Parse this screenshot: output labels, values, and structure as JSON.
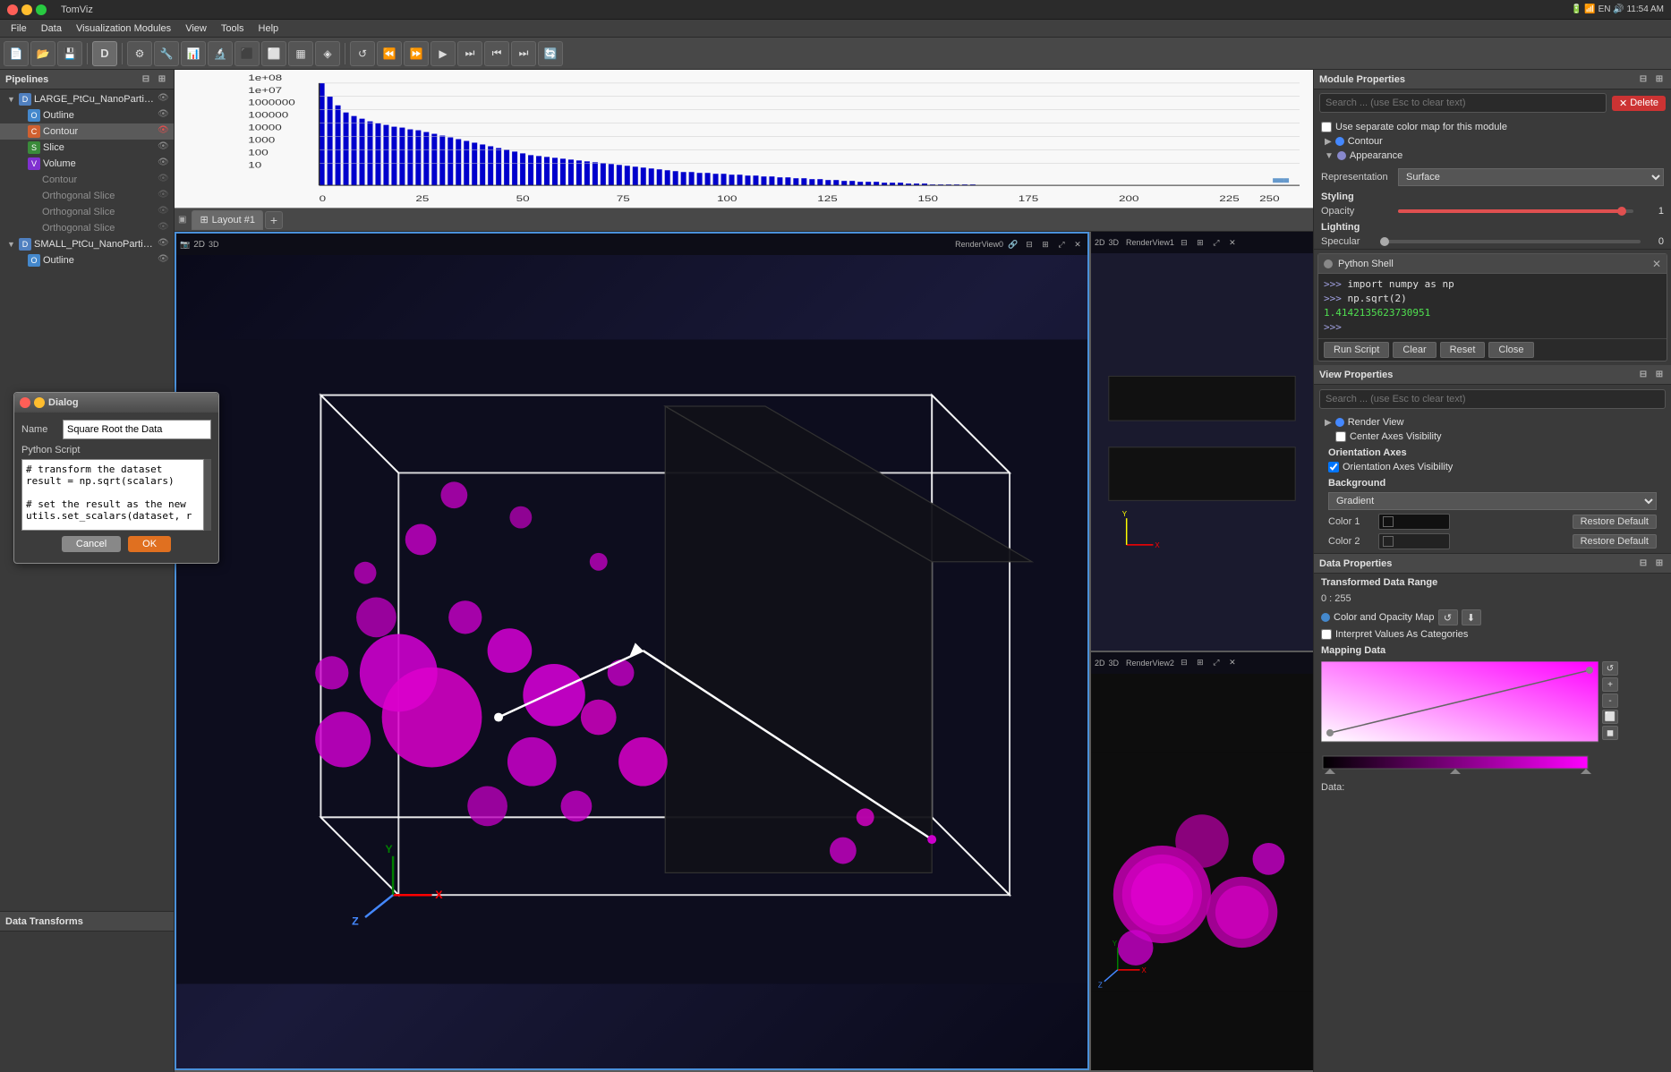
{
  "titlebar": {
    "title": "TomViz",
    "close_label": "×",
    "min_label": "−",
    "max_label": "□",
    "right_icons": "🔋 📶 EN 🔊 11:54 AM"
  },
  "menubar": {
    "items": [
      "File",
      "Data",
      "Visualization Modules",
      "View",
      "Tools",
      "Help"
    ]
  },
  "pipelines": {
    "header": "Pipelines",
    "items": [
      {
        "id": "large-dataset",
        "label": "LARGE_PtCu_NanoParticl...",
        "type": "dataset",
        "indent": 0,
        "expanded": true,
        "eye": true
      },
      {
        "id": "outline-1",
        "label": "Outline",
        "type": "outline",
        "indent": 1,
        "eye": true
      },
      {
        "id": "contour-1",
        "label": "Contour",
        "type": "contour",
        "indent": 1,
        "eye": true,
        "selected": true,
        "eye_red": true
      },
      {
        "id": "slice-1",
        "label": "Slice",
        "type": "slice",
        "indent": 1,
        "eye": true
      },
      {
        "id": "volume-1",
        "label": "Volume",
        "type": "volume",
        "indent": 1,
        "eye": true
      },
      {
        "id": "contour-2",
        "label": "Contour",
        "type": "contour",
        "indent": 2,
        "eye": false,
        "dimmed": true
      },
      {
        "id": "orthoslice-1",
        "label": "Orthogonal Slice",
        "type": "orthoslice",
        "indent": 2,
        "eye": false,
        "dimmed": true
      },
      {
        "id": "orthoslice-2",
        "label": "Orthogonal Slice",
        "type": "orthoslice",
        "indent": 2,
        "eye": false,
        "dimmed": true
      },
      {
        "id": "orthoslice-3",
        "label": "Orthogonal Slice",
        "type": "orthoslice",
        "indent": 2,
        "eye": false,
        "dimmed": true
      },
      {
        "id": "small-dataset",
        "label": "SMALL_PtCu_NanoParticl...",
        "type": "dataset",
        "indent": 0,
        "expanded": true,
        "eye": true
      },
      {
        "id": "outline-2",
        "label": "Outline",
        "type": "outline",
        "indent": 1,
        "eye": true
      }
    ]
  },
  "data_transforms": {
    "header": "Data Transforms"
  },
  "tabs": {
    "active": "Layout #1",
    "items": [
      "Layout #1"
    ]
  },
  "module_properties": {
    "header": "Module Properties",
    "search_placeholder": "Search ... (use Esc to clear text)",
    "delete_label": "Delete",
    "use_separate_colormap_label": "Use separate color map for this module",
    "modules": [
      {
        "label": "Contour",
        "color": "#4488ff"
      },
      {
        "label": "Appearance",
        "color": "#8888cc"
      }
    ],
    "representation_label": "Representation",
    "representation_value": "Surface",
    "styling": {
      "header": "Styling",
      "opacity_label": "Opacity",
      "opacity_value": "1",
      "opacity_percent": 95
    },
    "lighting": {
      "header": "Lighting",
      "specular_label": "Specular",
      "specular_value": "0"
    }
  },
  "python_shell": {
    "title": "Python Shell",
    "lines": [
      {
        "type": "prompt",
        "text": ">>> "
      },
      {
        "type": "command",
        "text": "import numpy as np"
      },
      {
        "type": "prompt2",
        "text": ">>> "
      },
      {
        "type": "command2",
        "text": "np.sqrt(2)"
      },
      {
        "type": "result",
        "text": "1.4142135623730951"
      },
      {
        "type": "prompt3",
        "text": ">>>"
      }
    ],
    "run_script_label": "Run Script",
    "clear_label": "Clear",
    "reset_label": "Reset",
    "close_label": "Close"
  },
  "view_properties": {
    "header": "View Properties",
    "search_placeholder": "Search ... (use Esc to clear text)",
    "render_view_label": "Render View",
    "center_axes_label": "Center Axes Visibility",
    "center_axes_checked": false,
    "orientation_axes_header": "Orientation Axes",
    "orientation_axes_label": "Orientation Axes Visibility",
    "orientation_axes_checked": true,
    "background_header": "Background",
    "background_value": "Gradient",
    "color1_label": "Color 1",
    "color2_label": "Color 2",
    "restore_default_label": "Restore Default"
  },
  "data_properties": {
    "header": "Data Properties",
    "transformed_range_header": "Transformed Data Range",
    "range_value": "0 : 255",
    "color_opacity_map_label": "Color and Opacity Map",
    "interpret_categories_label": "Interpret Values As Categories",
    "mapping_data_header": "Mapping Data",
    "data_label": "Data:"
  },
  "dialog": {
    "title": "Dialog",
    "name_label": "Name",
    "name_value": "Square Root the Data",
    "script_label": "Python Script",
    "script_value": "# transform the dataset\nresult = np.sqrt(scalars)\n\n# set the result as the new\nutils.set_scalars(dataset, r",
    "cancel_label": "Cancel",
    "ok_label": "OK"
  },
  "renderview0": {
    "label": "RenderView0",
    "view_label": "2D"
  },
  "renderview1": {
    "label": "RenderView1",
    "view_label": "2D"
  },
  "renderview2": {
    "label": "RenderView2",
    "view_label": "2D"
  }
}
